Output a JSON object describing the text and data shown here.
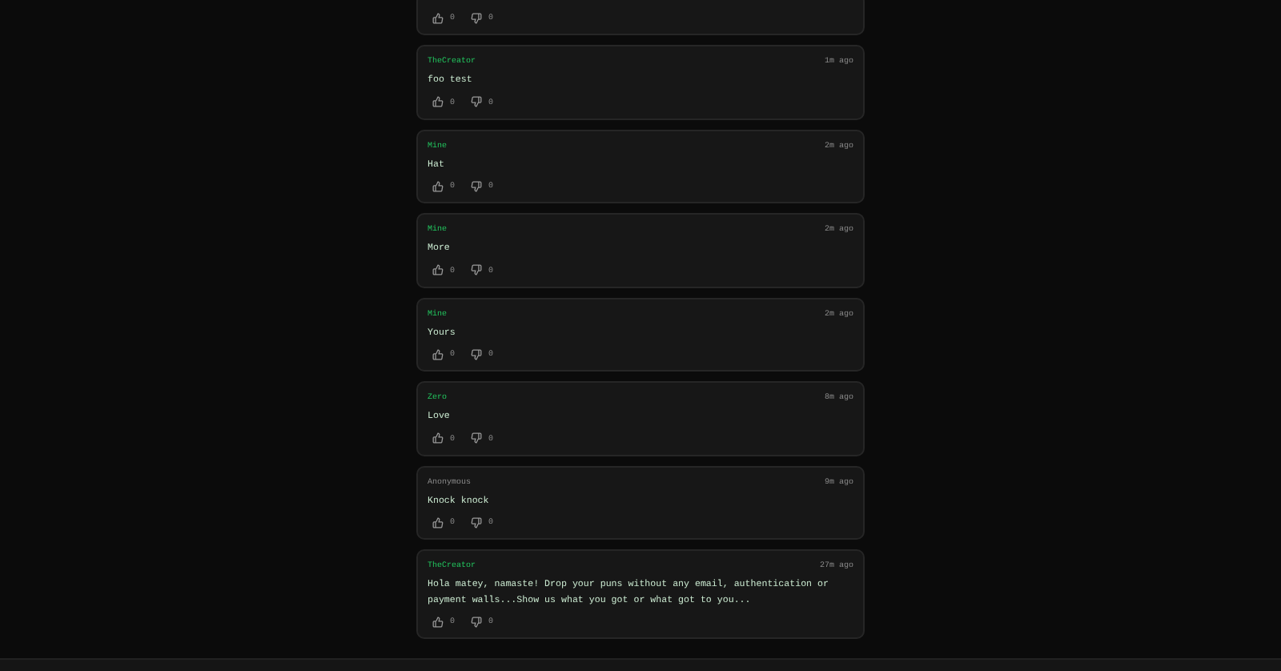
{
  "posts": [
    {
      "likes": "0",
      "dislikes": "0"
    },
    {
      "author": "TheCreator",
      "anonymous": false,
      "time": "1m ago",
      "text": "foo test",
      "likes": "0",
      "dislikes": "0"
    },
    {
      "author": "Mine",
      "anonymous": false,
      "time": "2m ago",
      "text": "Hat",
      "likes": "0",
      "dislikes": "0"
    },
    {
      "author": "Mine",
      "anonymous": false,
      "time": "2m ago",
      "text": "More",
      "likes": "0",
      "dislikes": "0"
    },
    {
      "author": "Mine",
      "anonymous": false,
      "time": "2m ago",
      "text": "Yours",
      "likes": "0",
      "dislikes": "0"
    },
    {
      "author": "Zero",
      "anonymous": false,
      "time": "8m ago",
      "text": "Love",
      "likes": "0",
      "dislikes": "0"
    },
    {
      "author": "Anonymous",
      "anonymous": true,
      "time": "9m ago",
      "text": "Knock knock",
      "likes": "0",
      "dislikes": "0"
    },
    {
      "author": "TheCreator",
      "anonymous": false,
      "time": "27m ago",
      "text": "Hola matey, namaste! Drop your puns without any email, authentication or payment walls...Show us what you got or what got to you...",
      "likes": "0",
      "dislikes": "0"
    }
  ]
}
